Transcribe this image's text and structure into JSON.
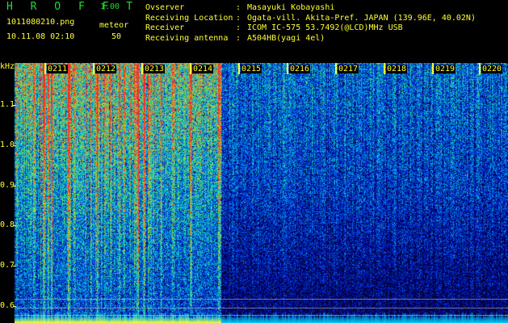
{
  "header": {
    "app_name": "H R O F F T",
    "app_version": "1.00",
    "file_name": "1011080210.png",
    "datetime": "10.11.08 02:10",
    "count_label": "meteor",
    "count_value": "50"
  },
  "station": [
    {
      "label": "Ovserver",
      "sep": ":",
      "value": "Masayuki Kobayashi"
    },
    {
      "label": "Receiving Location",
      "sep": ":",
      "value": "Ogata-vill. Akita-Pref. JAPAN (139.96E, 40.02N)"
    },
    {
      "label": "Receiver",
      "sep": ":",
      "value": "ICOM IC-575 53.7492(@LCD)MHz USB"
    },
    {
      "label": "Receiving antenna",
      "sep": ":",
      "value": "A504HB(yagi 4el)"
    }
  ],
  "spectrogram": {
    "y_unit": "kHz",
    "y_ticks": [
      "1.1",
      "1.0",
      "0.9",
      "0.8",
      "0.7",
      "0.6"
    ],
    "y_tick_values": [
      1.1,
      1.0,
      0.9,
      0.8,
      0.7,
      0.6
    ],
    "y_range": [
      0.555,
      1.205
    ],
    "time_labels": [
      "0211",
      "0212",
      "0213",
      "0214",
      "0215",
      "0216",
      "0217",
      "0218",
      "0219",
      "0220"
    ],
    "reference_lines_khz": [
      0.618,
      0.595,
      0.578
    ],
    "colors": {
      "background": "#000000",
      "text": "#ffff33",
      "title": "#22dd33"
    }
  }
}
